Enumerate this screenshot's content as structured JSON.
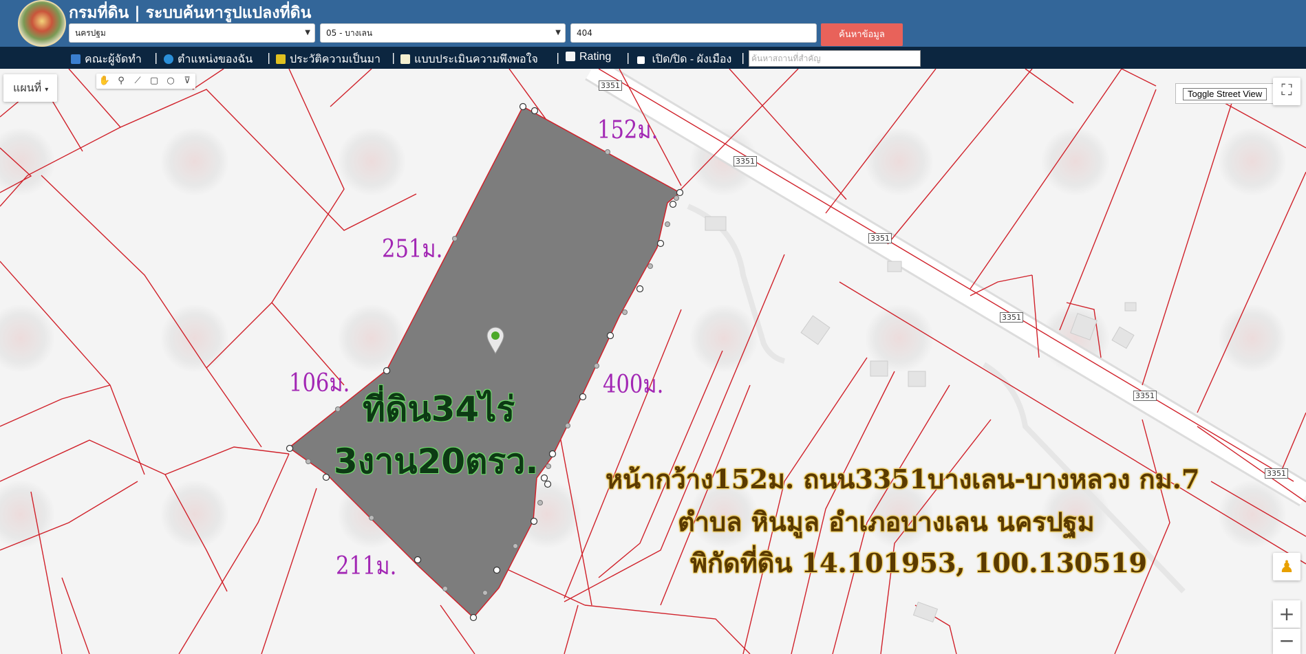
{
  "header": {
    "title": "กรมที่ดิน | ระบบค้นหารูปแปลงที่ดิน",
    "province": "นครปฐม",
    "district": "05 - บางเลน",
    "parcel_no": "404",
    "search_button": "ค้นหาข้อมูล"
  },
  "nav": {
    "items": [
      "คณะผู้จัดทำ",
      "ตำแหน่งของฉัน",
      "ประวัติความเป็นมา",
      "แบบประเมินความพึงพอใจ",
      "Rating",
      "เปิด/ปิด - ผังเมือง"
    ],
    "separator": "|",
    "place_search_placeholder": "ค้นหาสถานที่สำคัญ"
  },
  "map": {
    "map_type": "แผนที่",
    "street_view_button": "Toggle Street View",
    "measurements": {
      "top": "152ม.",
      "left_upper": "251ม.",
      "left_lower": "106ม.",
      "bottom": "211ม.",
      "right": "400ม."
    },
    "area_line1": "ที่ดิน34ไร่",
    "area_line2": "3งาน20ตรว.",
    "info_line1": "หน้ากว้าง152ม. ถนน3351บางเลน-บางหลวง กม.7",
    "info_line2": "ตำบล หินมูล อำเภอบางเลน นครปฐม",
    "info_line3": "พิกัดที่ดิน 14.101953, 100.130519",
    "road_number": "3351",
    "colors": {
      "header": "#336699",
      "navbar": "#0c2640",
      "parcel_fill": "#7d7d7d",
      "parcel_line": "#d0212a",
      "search_button": "#e8625a"
    }
  }
}
